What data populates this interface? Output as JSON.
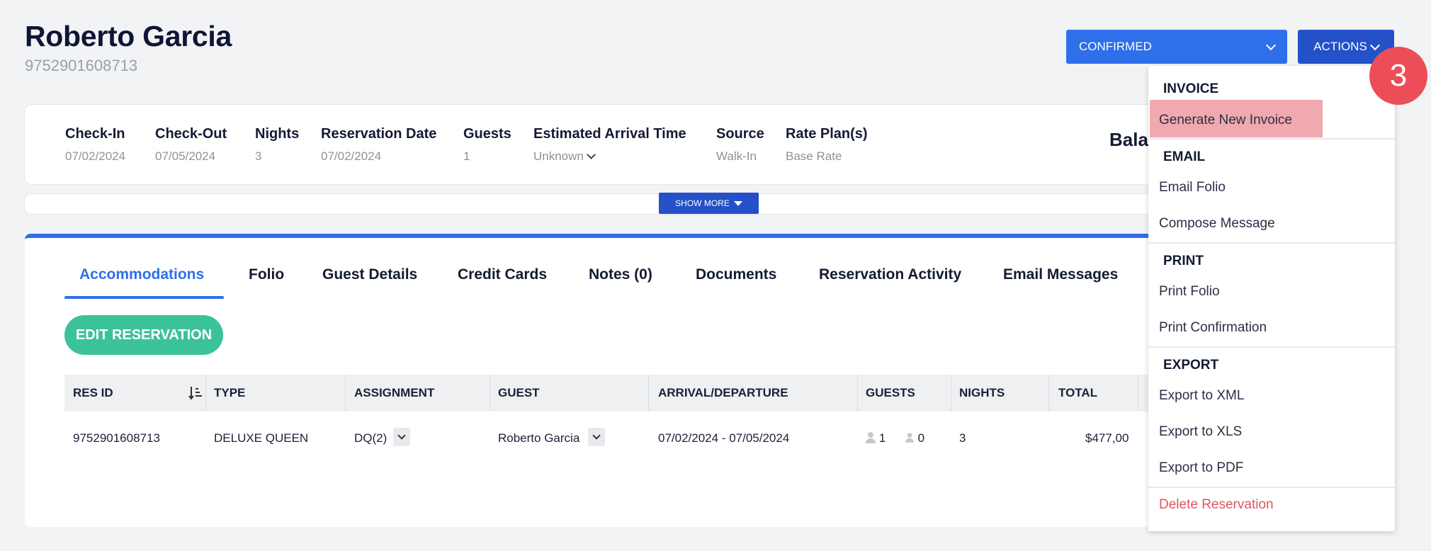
{
  "header": {
    "guest_name": "Roberto Garcia",
    "reservation_id": "9752901608713",
    "status": "CONFIRMED",
    "actions_label": "ACTIONS"
  },
  "info": {
    "fields": [
      {
        "label": "Check-In",
        "value": "07/02/2024"
      },
      {
        "label": "Check-Out",
        "value": "07/05/2024"
      },
      {
        "label": "Nights",
        "value": "3"
      },
      {
        "label": "Reservation Date",
        "value": "07/02/2024"
      },
      {
        "label": "Guests",
        "value": "1"
      },
      {
        "label": "Estimated Arrival Time",
        "value": "Unknown"
      },
      {
        "label": "Source",
        "value": "Walk-In"
      },
      {
        "label": "Rate Plan(s)",
        "value": "Base Rate"
      }
    ],
    "balance_partial": "Bala",
    "show_more": "SHOW MORE"
  },
  "tabs": [
    {
      "label": "Accommodations",
      "active": true
    },
    {
      "label": "Folio"
    },
    {
      "label": "Guest Details"
    },
    {
      "label": "Credit Cards"
    },
    {
      "label": "Notes (0)"
    },
    {
      "label": "Documents"
    },
    {
      "label": "Reservation Activity"
    },
    {
      "label": "Email Messages"
    }
  ],
  "edit_button": "EDIT RESERVATION",
  "table": {
    "headers": [
      "RES ID",
      "TYPE",
      "ASSIGNMENT",
      "GUEST",
      "ARRIVAL/DEPARTURE",
      "GUESTS",
      "NIGHTS",
      "TOTAL"
    ],
    "row": {
      "res_id": "9752901608713",
      "type": "DELUXE QUEEN",
      "assignment": "DQ(2)",
      "guest": "Roberto Garcia",
      "dates": "07/02/2024 - 07/05/2024",
      "adults": "1",
      "children": "0",
      "nights": "3",
      "total": "$477,00"
    }
  },
  "menu": {
    "invoice_header": "INVOICE",
    "generate_invoice": "Generate New Invoice",
    "email_header": "EMAIL",
    "email_folio": "Email Folio",
    "compose_message": "Compose Message",
    "print_header": "PRINT",
    "print_folio": "Print Folio",
    "print_confirmation": "Print Confirmation",
    "export_header": "EXPORT",
    "export_xml": "Export to XML",
    "export_xls": "Export to XLS",
    "export_pdf": "Export to PDF",
    "delete_reservation": "Delete Reservation"
  },
  "step_badge": "3",
  "colors": {
    "primary": "#2f6fea",
    "actions": "#2450c8",
    "edit": "#3cc29a",
    "highlight": "#f0a9ae",
    "danger": "#e05561",
    "badge": "#eb4e57"
  }
}
